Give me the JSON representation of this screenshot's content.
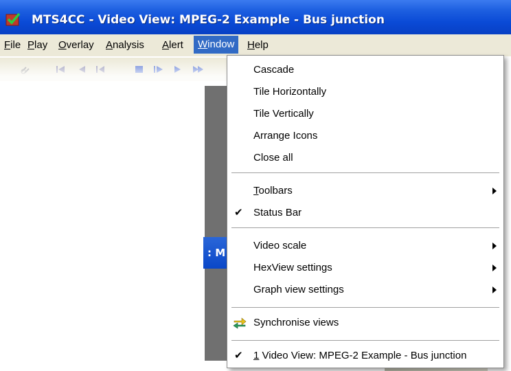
{
  "window": {
    "title": "MTS4CC - Video View: MPEG-2 Example - Bus junction",
    "icon": "app-icon"
  },
  "menubar": {
    "items": [
      {
        "label_first": "F",
        "label_rest": "ile"
      },
      {
        "label_first": "P",
        "label_rest": "lay"
      },
      {
        "label_first": "O",
        "label_rest": "verlay"
      },
      {
        "label_first": "A",
        "label_rest": "nalysis"
      },
      {
        "label_first": "A",
        "label_rest": "lert"
      },
      {
        "label_first": "W",
        "label_rest": "indow"
      },
      {
        "label_first": "H",
        "label_rest": "elp"
      }
    ],
    "active": "Window",
    "highlight_color": "#316ac5"
  },
  "toolbar": {
    "icons": [
      "link-icon",
      "skip-back-icon",
      "step-back-icon",
      "rewind-icon",
      "stop-icon",
      "play-icon",
      "step-forward-icon",
      "fast-forward-icon"
    ]
  },
  "doc_title_fragment": ": M",
  "window_menu": {
    "group1": [
      "Cascade",
      "Tile Horizontally",
      "Tile Vertically",
      "Arrange Icons",
      "Close all"
    ],
    "toolbars": {
      "first": "T",
      "rest": "oolbars",
      "submenu": true
    },
    "status_bar": {
      "label": "Status Bar",
      "checked": true
    },
    "group3": [
      {
        "label": "Video scale",
        "submenu": true
      },
      {
        "label": "HexView settings",
        "submenu": true
      },
      {
        "label": "Graph view settings",
        "submenu": true
      }
    ],
    "synchronise": {
      "label": "Synchronise views",
      "icon": "sync-icon"
    },
    "window_entry": {
      "number": "1",
      "label": " Video View: MPEG-2 Example - Bus junction",
      "checked": true
    }
  }
}
